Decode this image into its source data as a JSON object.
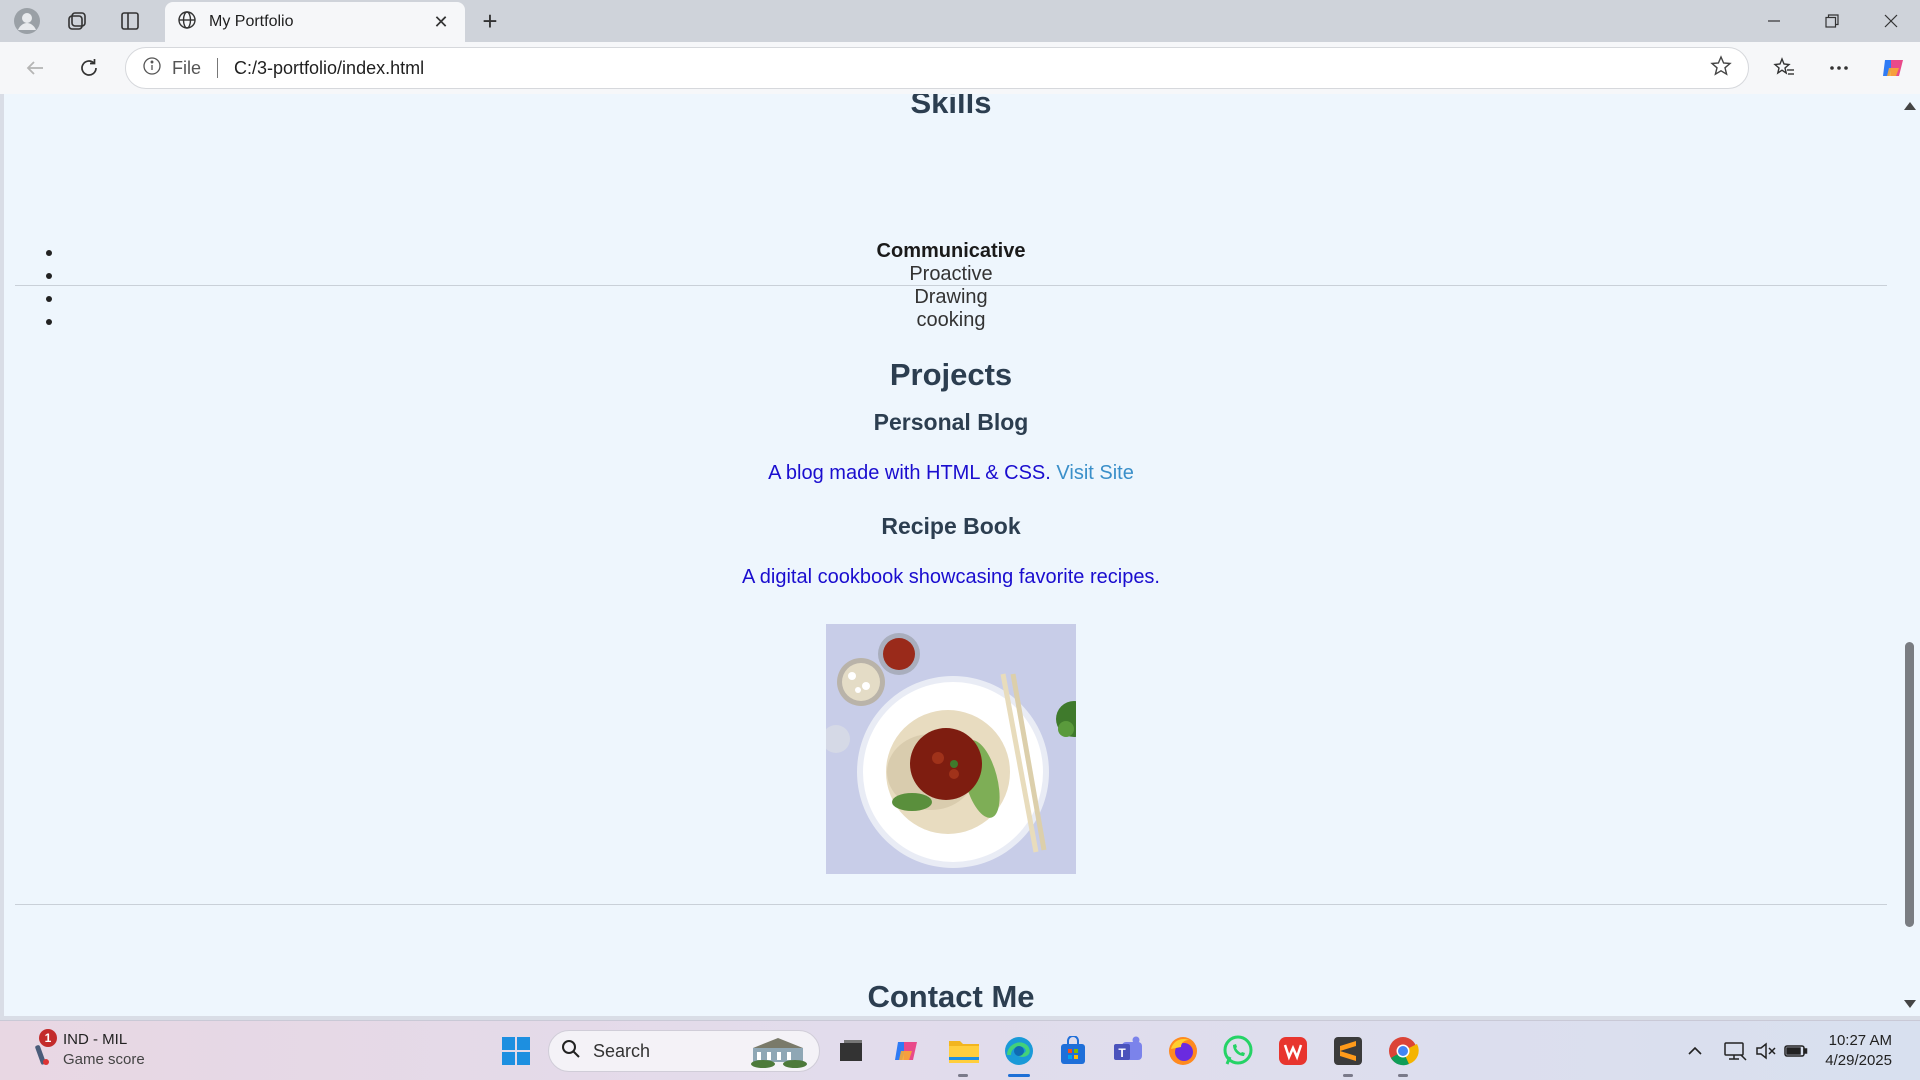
{
  "browser": {
    "tab_title": "My Portfolio",
    "address_prefix": "File",
    "url": "C:/3-portfolio/index.html"
  },
  "page": {
    "skills": {
      "heading": "Skills",
      "items": [
        "Communicative",
        "Proactive",
        "Drawing",
        "cooking"
      ]
    },
    "projects": {
      "heading": "Projects",
      "items": [
        {
          "title": "Personal Blog",
          "description": "A blog made with HTML & CSS.",
          "link": "Visit Site"
        },
        {
          "title": "Recipe Book",
          "description": "A digital cookbook showcasing favorite recipes."
        }
      ]
    },
    "contact": {
      "heading": "Contact Me"
    }
  },
  "taskbar": {
    "widget": {
      "title": "IND - MIL",
      "subtitle": "Game score",
      "badge": "1"
    },
    "search_placeholder": "Search",
    "time": "10:27 AM",
    "date": "4/29/2025"
  },
  "icons": [
    "profile-icon",
    "collections-icon",
    "vertical-tabs-icon",
    "globe-icon",
    "close-icon",
    "plus-icon",
    "minimize-icon",
    "restore-icon",
    "window-close-icon",
    "back-arrow-icon",
    "refresh-icon",
    "info-icon",
    "star-icon",
    "favorites-icon",
    "more-icon",
    "copilot-icon",
    "windows-start-icon",
    "search-icon",
    "file-explorer-icon",
    "edge-icon",
    "store-icon",
    "teams-icon",
    "firefox-icon",
    "whatsapp-icon",
    "wps-icon",
    "sublime-icon",
    "chrome-icon"
  ],
  "colors": {
    "page_background": "#eef6fd",
    "heading": "#2c3e50",
    "paragraph": "#1a0dcf",
    "link": "#3a8fc9"
  }
}
